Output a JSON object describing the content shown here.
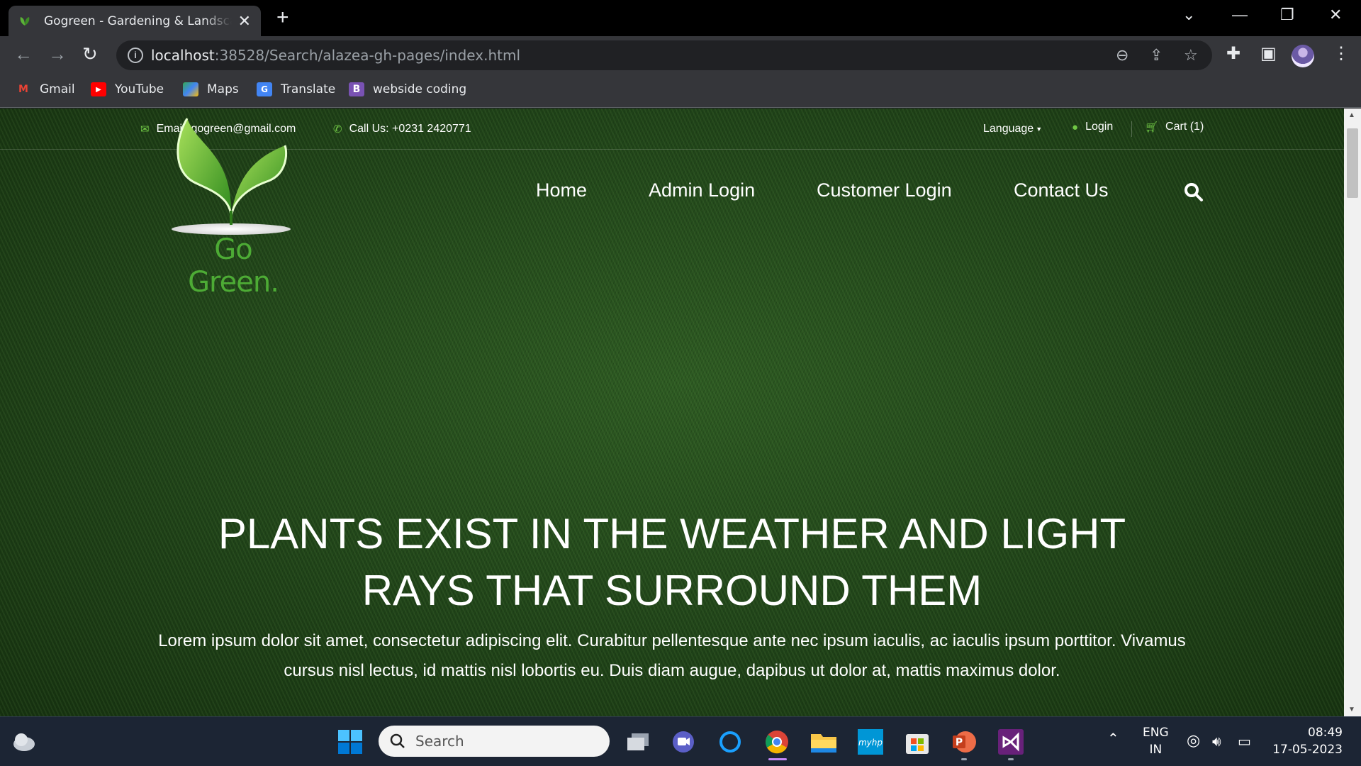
{
  "browser": {
    "tab_title": "Gogreen - Gardening & Landscaping",
    "url_host": "localhost",
    "url_path": ":38528/Search/alazea-gh-pages/index.html",
    "bookmarks": [
      "Gmail",
      "YouTube",
      "Maps",
      "Translate",
      "webside coding"
    ]
  },
  "page": {
    "topbar": {
      "email": "Email: gogreen@gmail.com",
      "phone": "Call Us: +0231 2420771",
      "language": "Language",
      "login": "Login",
      "cart": "Cart (1)"
    },
    "logo_text": "Go Green.",
    "nav": [
      "Home",
      "Admin Login",
      "Customer Login",
      "Contact Us"
    ],
    "hero": {
      "title_line1": "PLANTS EXIST IN THE WEATHER AND LIGHT",
      "title_line2": "RAYS THAT SURROUND THEM",
      "text_line1": "Lorem ipsum dolor sit amet, consectetur adipiscing elit. Curabitur pellentesque ante nec ipsum iaculis, ac iaculis ipsum porttitor. Vivamus",
      "text_line2": "cursus nisl lectus, id mattis nisl lobortis eu. Duis diam augue, dapibus ut dolor at, mattis maximus dolor."
    },
    "colors": {
      "accent": "#70c745",
      "grass": "#1f4218"
    }
  },
  "taskbar": {
    "search_placeholder": "Search",
    "lang_line1": "ENG",
    "lang_line2": "IN",
    "time": "08:49",
    "date": "17-05-2023"
  }
}
